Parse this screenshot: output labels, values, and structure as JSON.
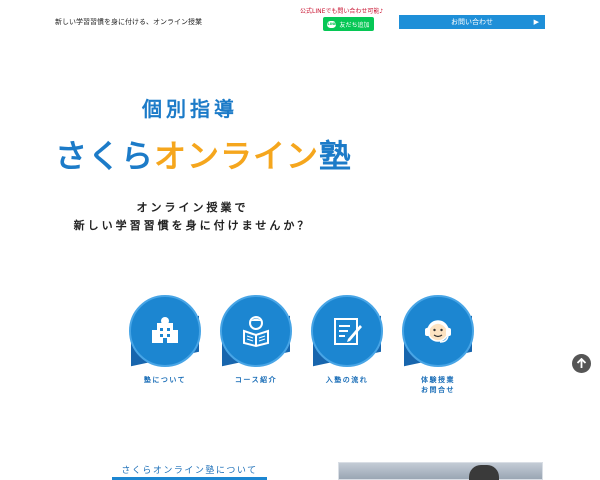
{
  "header": {
    "tagline": "新しい学習習慣を身に付ける、オンライン授業",
    "line_note": "公式LINEでも問い合わせ可能♪",
    "line_button_label": "友だち追加",
    "line_logo_text": "LINE",
    "contact_button_label": "お問い合わせ"
  },
  "hero": {
    "sub_title": "個別指導",
    "title_part1": "さくら",
    "title_part2": "オンライン",
    "title_part3": "塾",
    "catch_line1": "オンライン授業で",
    "catch_line2": "新しい学習習慣を身に付けませんか？"
  },
  "features": [
    {
      "label_line1": "塾について",
      "label_line2": "",
      "icon": "school-building-icon"
    },
    {
      "label_line1": "コース紹介",
      "label_line2": "",
      "icon": "reading-student-icon"
    },
    {
      "label_line1": "入塾の流れ",
      "label_line2": "",
      "icon": "checklist-icon"
    },
    {
      "label_line1": "体験授業",
      "label_line2": "お問合せ",
      "icon": "support-headset-icon"
    }
  ],
  "about": {
    "heading": "さくらオンライン塾について"
  },
  "colors": {
    "brand_blue": "#1c86d1",
    "title_orange": "#f5a61d",
    "line_green": "#06c755"
  }
}
